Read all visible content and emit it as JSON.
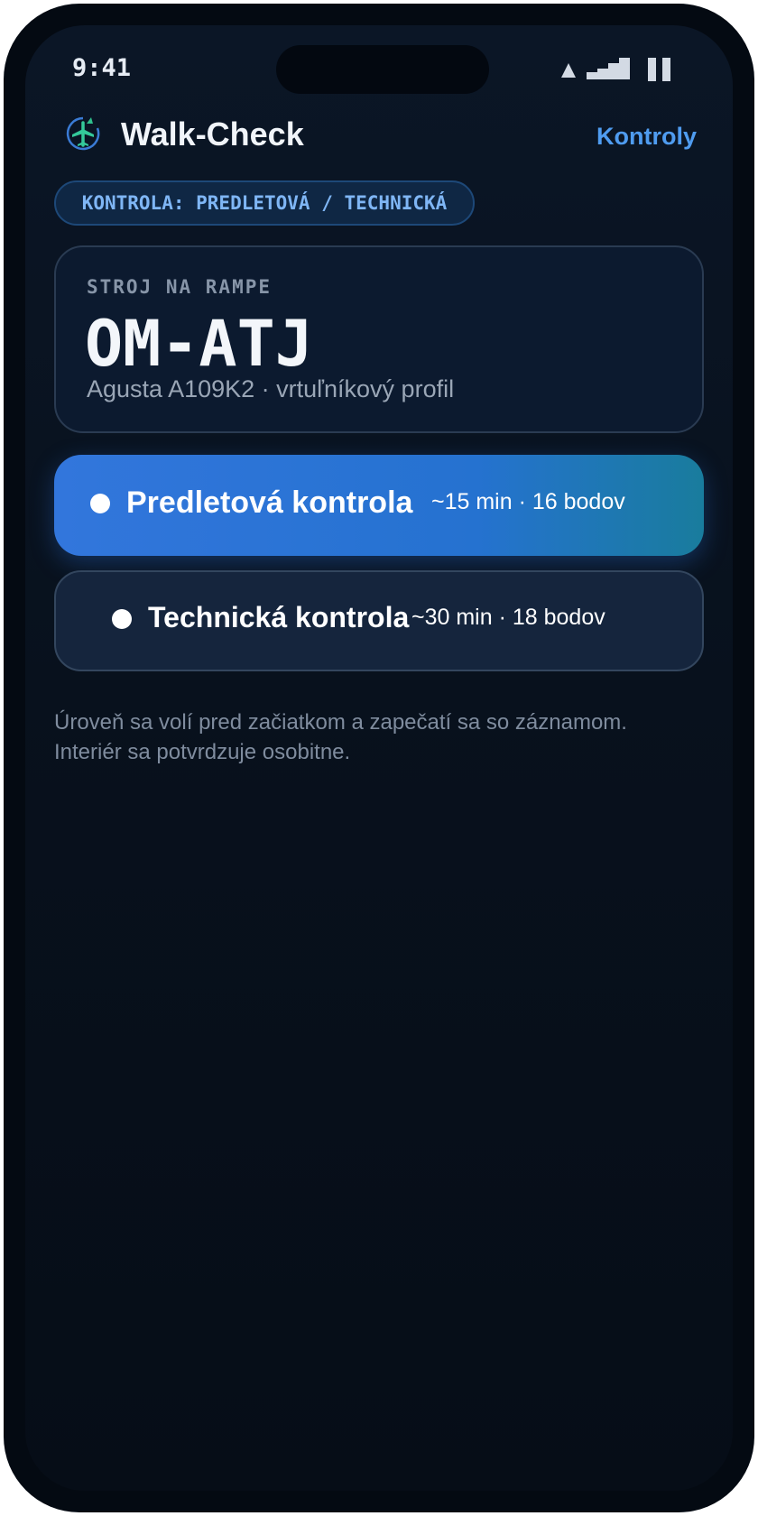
{
  "status_bar": {
    "time": "9:41"
  },
  "header": {
    "title": "Walk-Check",
    "nav_link": "Kontroly"
  },
  "chip": {
    "label": "KONTROLA: PREDLETOVÁ / TECHNICKÁ"
  },
  "aircraft": {
    "label": "STROJ NA RAMPE",
    "registration": "OM-ATJ",
    "type": "Agusta A109K2 · vrtuľníkový profil"
  },
  "options": [
    {
      "name": "Predletová kontrola",
      "meta": "~15 min · 16 bodov",
      "selected": true
    },
    {
      "name": "Technická kontrola",
      "meta": "~30 min · 18 bodov",
      "selected": false
    }
  ],
  "footnote": {
    "line1": "Úroveň sa volí pred začiatkom a zapečatí sa so záznamom.",
    "line2": "Interiér sa potvrdzuje osobitne."
  },
  "colors": {
    "accent": "#4f9cf0",
    "primary_button_start": "#3276dc",
    "primary_button_end": "#197c9d",
    "background": "#08111d"
  },
  "icons": {
    "app_logo": "plane-in-circle-icon",
    "status": [
      "wifi-icon",
      "signal-icon",
      "battery-icon"
    ]
  }
}
